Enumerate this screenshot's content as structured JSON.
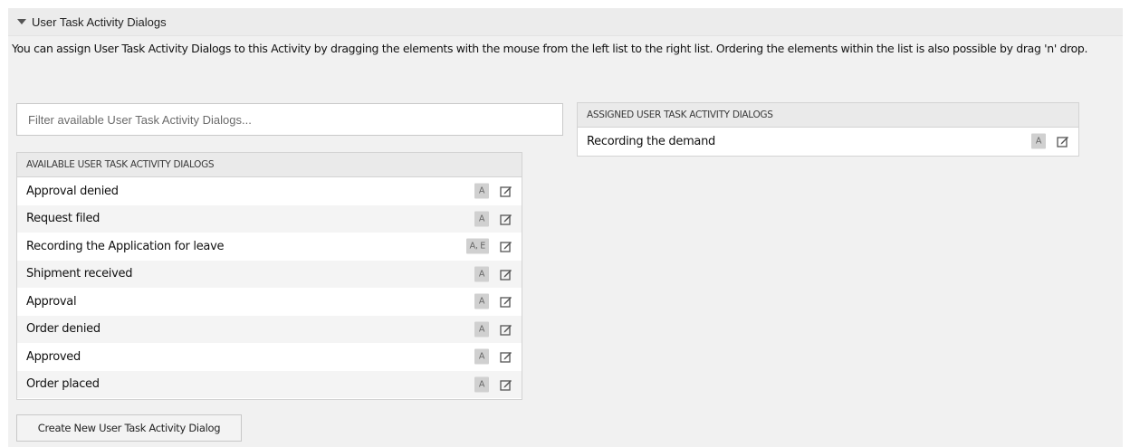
{
  "panel": {
    "title": "User Task Activity Dialogs",
    "description": "You can assign User Task Activity Dialogs to this Activity by dragging the elements with the mouse from the left list to the right list. Ordering the elements within the list is also possible by drag 'n' drop."
  },
  "filter": {
    "placeholder": "Filter available User Task Activity Dialogs..."
  },
  "available": {
    "header": "AVAILABLE USER TASK ACTIVITY DIALOGS",
    "items": [
      {
        "label": "Approval denied",
        "badge": "A"
      },
      {
        "label": "Request filed",
        "badge": "A"
      },
      {
        "label": "Recording the Application for leave",
        "badge": "A, E"
      },
      {
        "label": "Shipment received",
        "badge": "A"
      },
      {
        "label": "Approval",
        "badge": "A"
      },
      {
        "label": "Order denied",
        "badge": "A"
      },
      {
        "label": "Approved",
        "badge": "A"
      },
      {
        "label": "Order placed",
        "badge": "A"
      }
    ]
  },
  "assigned": {
    "header": "ASSIGNED USER TASK ACTIVITY DIALOGS",
    "items": [
      {
        "label": "Recording the demand",
        "badge": "A"
      }
    ]
  },
  "create_button": "Create New User Task Activity Dialog",
  "icons": {
    "collapse": "caret-down-icon",
    "edit": "edit-icon"
  }
}
